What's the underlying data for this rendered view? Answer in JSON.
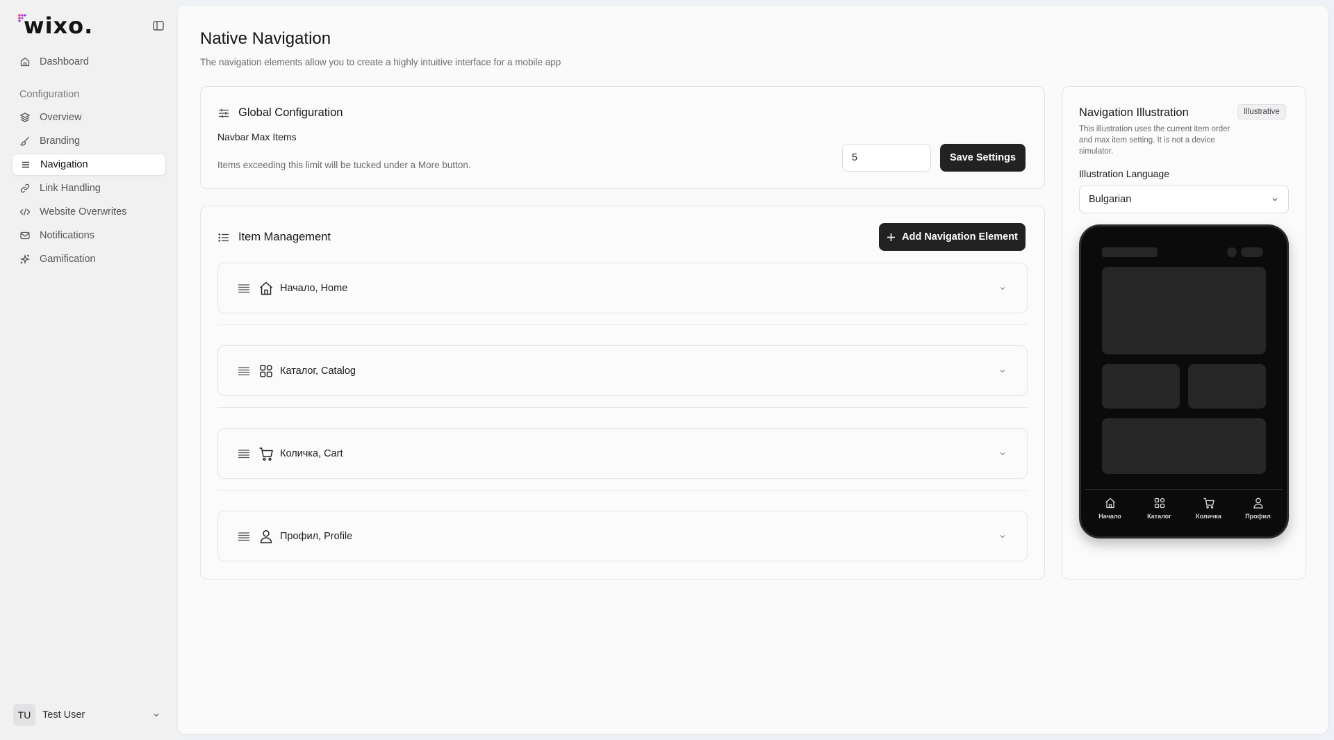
{
  "app": {
    "logo_text": "wixo.",
    "colors": {
      "accent_dark": "#222222",
      "logo_dots": [
        "#e91e8c",
        "#7c3aed",
        "#a855f7"
      ]
    }
  },
  "sidebar": {
    "collapse_icon": "sidebar-toggle-icon",
    "top_item": {
      "label": "Dashboard",
      "icon": "home-icon"
    },
    "section_label": "Configuration",
    "items": [
      {
        "label": "Overview",
        "icon": "layers-icon",
        "active": false
      },
      {
        "label": "Branding",
        "icon": "brush-icon",
        "active": false
      },
      {
        "label": "Navigation",
        "icon": "menu-icon",
        "active": true
      },
      {
        "label": "Link Handling",
        "icon": "link-icon",
        "active": false
      },
      {
        "label": "Website Overwrites",
        "icon": "code-icon",
        "active": false
      },
      {
        "label": "Notifications",
        "icon": "mail-icon",
        "active": false
      },
      {
        "label": "Gamification",
        "icon": "sparkles-icon",
        "active": false
      }
    ],
    "user": {
      "initials": "TU",
      "name": "Test User"
    }
  },
  "page": {
    "title": "Native Navigation",
    "subtitle": "The navigation elements allow you to create a highly intuitive interface for a mobile app"
  },
  "global_config": {
    "title": "Global Configuration",
    "field_label": "Navbar Max Items",
    "hint": "Items exceeding this limit will be tucked under a More button.",
    "max_items_value": "5",
    "save_label": "Save Settings"
  },
  "item_management": {
    "title": "Item Management",
    "add_label": "Add Navigation Element",
    "elements": [
      {
        "label": "Начало, Home",
        "icon": "home-icon"
      },
      {
        "label": "Каталог, Catalog",
        "icon": "grid-icon"
      },
      {
        "label": "Количка, Cart",
        "icon": "cart-icon"
      },
      {
        "label": "Профил, Profile",
        "icon": "user-icon"
      }
    ]
  },
  "illustration": {
    "title": "Navigation Illustration",
    "badge": "Illustrative",
    "description": "This illustration uses the current item order and max item setting. It is not a device simulator.",
    "language_label": "Illustration Language",
    "language_value": "Bulgarian",
    "tabs": [
      {
        "label": "Начало",
        "icon": "home-icon"
      },
      {
        "label": "Каталог",
        "icon": "grid-icon"
      },
      {
        "label": "Количка",
        "icon": "cart-icon"
      },
      {
        "label": "Профил",
        "icon": "user-icon"
      }
    ]
  }
}
